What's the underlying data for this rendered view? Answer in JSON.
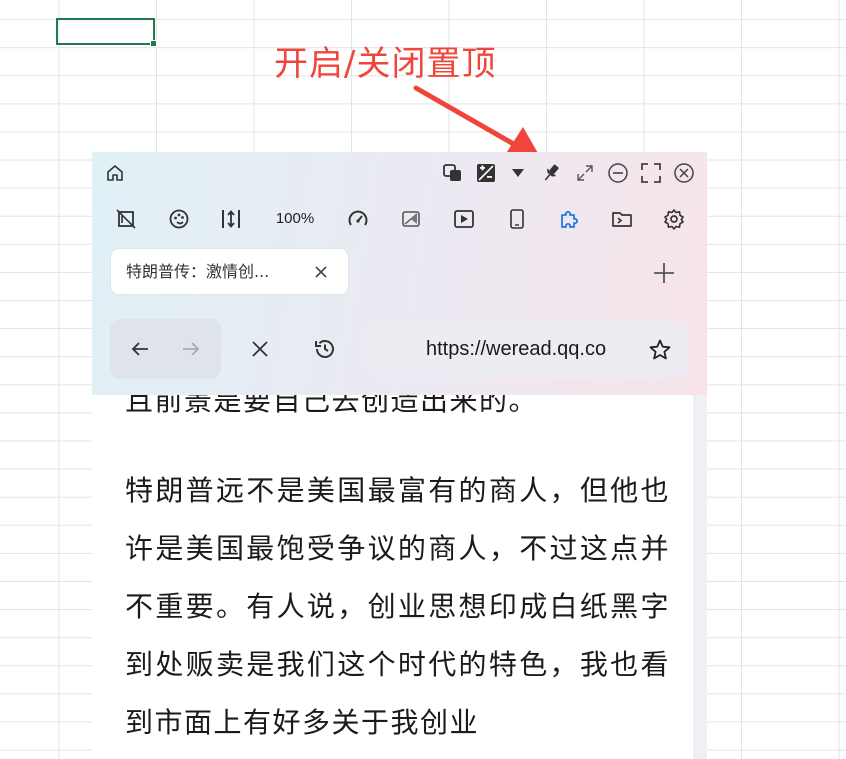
{
  "annotation": {
    "text": "开启/关闭置顶",
    "color": "#f0453a"
  },
  "toolbar": {
    "zoom_value": "100%"
  },
  "tab": {
    "title": "特朗普传：激情创..."
  },
  "address_bar": {
    "url": "https://weread.qq.co"
  },
  "content": {
    "partial_line": "且前景是要自己去创造出来的。",
    "paragraph": "特朗普远不是美国最富有的商人，但他也许是美国最饱受争议的商人，不过这点并不重要。有人说，创业思想印成白纸黑字到处贩卖是我们这个时代的特色，我也看到市面上有好多关于我创业"
  },
  "colors": {
    "active_accent": "#1e7be0",
    "sheet_selection": "#1f7a4d"
  }
}
